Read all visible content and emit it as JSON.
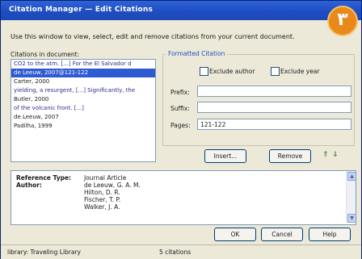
{
  "window": {
    "title": "Citation Manager — Edit Citations"
  },
  "badge": "٣",
  "instruction": "Use this window to view, select, edit and remove citations from your current document.",
  "citations": {
    "label": "Citations in document:",
    "items": [
      {
        "text": "CO2 to the atm. [...] For the El Salvador d",
        "kind": "text"
      },
      {
        "text": "de Leeuw, 2007@121-122",
        "kind": "sel"
      },
      {
        "text": "Carter, 2000",
        "kind": "ref"
      },
      {
        "text": "yielding, a resurgent, [...] Significantly, the",
        "kind": "text"
      },
      {
        "text": "Butler, 2000",
        "kind": "ref"
      },
      {
        "text": "of the volcanic front. [...]",
        "kind": "text"
      },
      {
        "text": "de Leeuw, 2007",
        "kind": "ref"
      },
      {
        "text": "Padilha, 1999",
        "kind": "ref"
      }
    ]
  },
  "formatted": {
    "label": "Formatted Citation",
    "exclude_author": "Exclude author",
    "exclude_year": "Exclude year",
    "prefix_label": "Prefix:",
    "prefix_value": "",
    "suffix_label": "Suffix:",
    "suffix_value": "",
    "pages_label": "Pages:",
    "pages_value": "121-122"
  },
  "buttons": {
    "insert": "Insert...",
    "remove": "Remove",
    "ok": "OK",
    "cancel": "Cancel",
    "help": "Help"
  },
  "reference": {
    "type_label": "Reference Type:",
    "type_value": "Journal Article",
    "author_label": "Author:",
    "authors": [
      "de Leeuw, G. A. M.",
      "Hilton, D. R.",
      "Fischer, T. P.",
      "Walker, J. A."
    ]
  },
  "status": {
    "library": "library: Traveling Library",
    "count": "5 citations"
  }
}
